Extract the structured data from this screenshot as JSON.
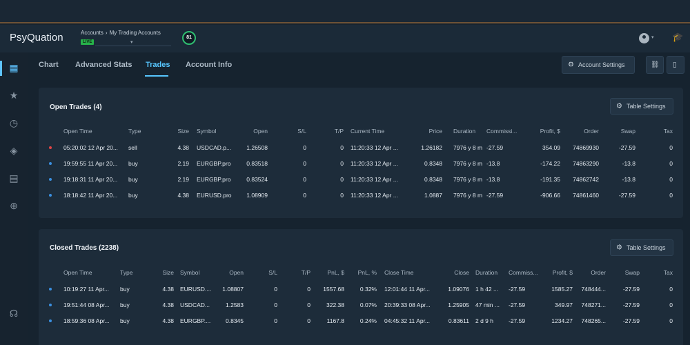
{
  "header": {
    "logo": "PsyQuation",
    "breadcrumb": [
      "Accounts",
      "My Trading Accounts"
    ],
    "live_badge": "LIVE",
    "score": "81"
  },
  "tabs": [
    {
      "label": "Chart"
    },
    {
      "label": "Advanced Stats"
    },
    {
      "label": "Trades",
      "active": true
    },
    {
      "label": "Account Info"
    }
  ],
  "toolbar": {
    "account_settings": "Account Settings"
  },
  "open_trades": {
    "title": "Open Trades (4)",
    "settings_label": "Table Settings",
    "columns": [
      "Open Time",
      "Type",
      "Size",
      "Symbol",
      "Open",
      "S/L",
      "T/P",
      "Current Time",
      "Price",
      "Duration",
      "Commissi...",
      "Profit, $",
      "Order",
      "Swap",
      "Tax"
    ],
    "rows": [
      {
        "marker": "#e04545",
        "cells": [
          "05:20:02 12 Apr 20...",
          "sell",
          "4.38",
          "USDCAD.p...",
          "1.26508",
          "0",
          "0",
          "11:20:33 12 Apr ...",
          "1.26182",
          "7976 y 8 m",
          "-27.59",
          "354.09",
          "74869930",
          "-27.59",
          "0"
        ]
      },
      {
        "marker": "#3b8fe0",
        "cells": [
          "19:59:55 11 Apr 20...",
          "buy",
          "2.19",
          "EURGBP.pro",
          "0.83518",
          "0",
          "0",
          "11:20:33 12 Apr ...",
          "0.8348",
          "7976 y 8 m",
          "-13.8",
          "-174.22",
          "74863290",
          "-13.8",
          "0"
        ]
      },
      {
        "marker": "#3b8fe0",
        "cells": [
          "19:18:31 11 Apr 20...",
          "buy",
          "2.19",
          "EURGBP.pro",
          "0.83524",
          "0",
          "0",
          "11:20:33 12 Apr ...",
          "0.8348",
          "7976 y 8 m",
          "-13.8",
          "-191.35",
          "74862742",
          "-13.8",
          "0"
        ]
      },
      {
        "marker": "#3b8fe0",
        "cells": [
          "18:18:42 11 Apr 20...",
          "buy",
          "4.38",
          "EURUSD.pro",
          "1.08909",
          "0",
          "0",
          "11:20:33 12 Apr ...",
          "1.0887",
          "7976 y 8 m",
          "-27.59",
          "-906.66",
          "74861460",
          "-27.59",
          "0"
        ]
      }
    ]
  },
  "closed_trades": {
    "title": "Closed Trades (2238)",
    "settings_label": "Table Settings",
    "columns": [
      "Open Time",
      "Type",
      "Size",
      "Symbol",
      "Open",
      "S/L",
      "T/P",
      "PnL, $",
      "PnL, %",
      "Close Time",
      "Close",
      "Duration",
      "Commiss...",
      "Profit, $",
      "Order",
      "Swap",
      "Tax"
    ],
    "rows": [
      {
        "marker": "#3b8fe0",
        "cells": [
          "10:19:27 11 Apr...",
          "buy",
          "4.38",
          "EURUSD....",
          "1.08807",
          "0",
          "0",
          "1557.68",
          "0.32%",
          "12:01:44 11 Apr...",
          "1.09076",
          "1 h 42 ...",
          "-27.59",
          "1585.27",
          "748444...",
          "-27.59",
          "0"
        ]
      },
      {
        "marker": "#3b8fe0",
        "cells": [
          "19:51:44 08 Apr...",
          "buy",
          "4.38",
          "USDCAD...",
          "1.2583",
          "0",
          "0",
          "322.38",
          "0.07%",
          "20:39:33 08 Apr...",
          "1.25905",
          "47 min ...",
          "-27.59",
          "349.97",
          "748271...",
          "-27.59",
          "0"
        ]
      },
      {
        "marker": "#3b8fe0",
        "cells": [
          "18:59:36 08 Apr...",
          "buy",
          "4.38",
          "EURGBP....",
          "0.8345",
          "0",
          "0",
          "1167.8",
          "0.24%",
          "04:45:32 11 Apr...",
          "0.83611",
          "2 d 9 h",
          "-27.59",
          "1234.27",
          "748265...",
          "-27.59",
          "0"
        ]
      }
    ]
  },
  "icons": {
    "sidebar": [
      "dashboard-icon",
      "stars-icon",
      "clock-icon",
      "layers-icon",
      "reports-icon",
      "add-icon",
      "headset-icon"
    ],
    "toolbar": [
      "gear-icon",
      "link-icon",
      "document-icon"
    ]
  },
  "colors": {
    "accent": "#57c6ff",
    "live": "#27b24a",
    "sell_marker": "#e04545",
    "buy_marker": "#3b8fe0"
  }
}
